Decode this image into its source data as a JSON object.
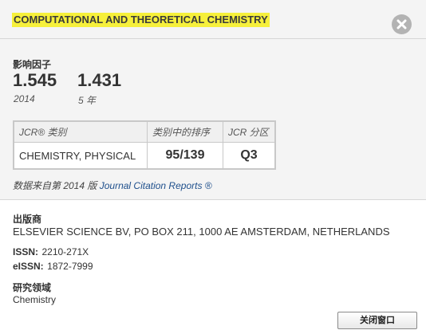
{
  "journal_title": "COMPUTATIONAL AND THEORETICAL CHEMISTRY",
  "impact_factor": {
    "label": "影响因子",
    "values": [
      {
        "value": "1.545",
        "period": "2014"
      },
      {
        "value": "1.431",
        "period": "5 年"
      }
    ]
  },
  "jcr_table": {
    "headers": [
      "JCR® 类别",
      "类别中的排序",
      "JCR 分区"
    ],
    "rows": [
      {
        "category": "CHEMISTRY, PHYSICAL",
        "rank": "95/139",
        "quartile": "Q3"
      }
    ]
  },
  "source": {
    "prefix": "数据来自第 2014 版",
    "link": "Journal Citation Reports ®"
  },
  "publisher": {
    "label": "出版商",
    "value": "ELSEVIER SCIENCE BV, PO BOX 211, 1000 AE AMSTERDAM, NETHERLANDS"
  },
  "issn": {
    "label": "ISSN:",
    "value": "2210-271X"
  },
  "eissn": {
    "label": "eISSN:",
    "value": "1872-7999"
  },
  "research_area": {
    "label": "研究领域",
    "value": "Chemistry"
  },
  "buttons": {
    "close_window": "关闭窗口"
  },
  "colors": {
    "highlight": "#f6f03b",
    "link": "#1e4f8c",
    "close_icon": "#b3b3b3"
  }
}
